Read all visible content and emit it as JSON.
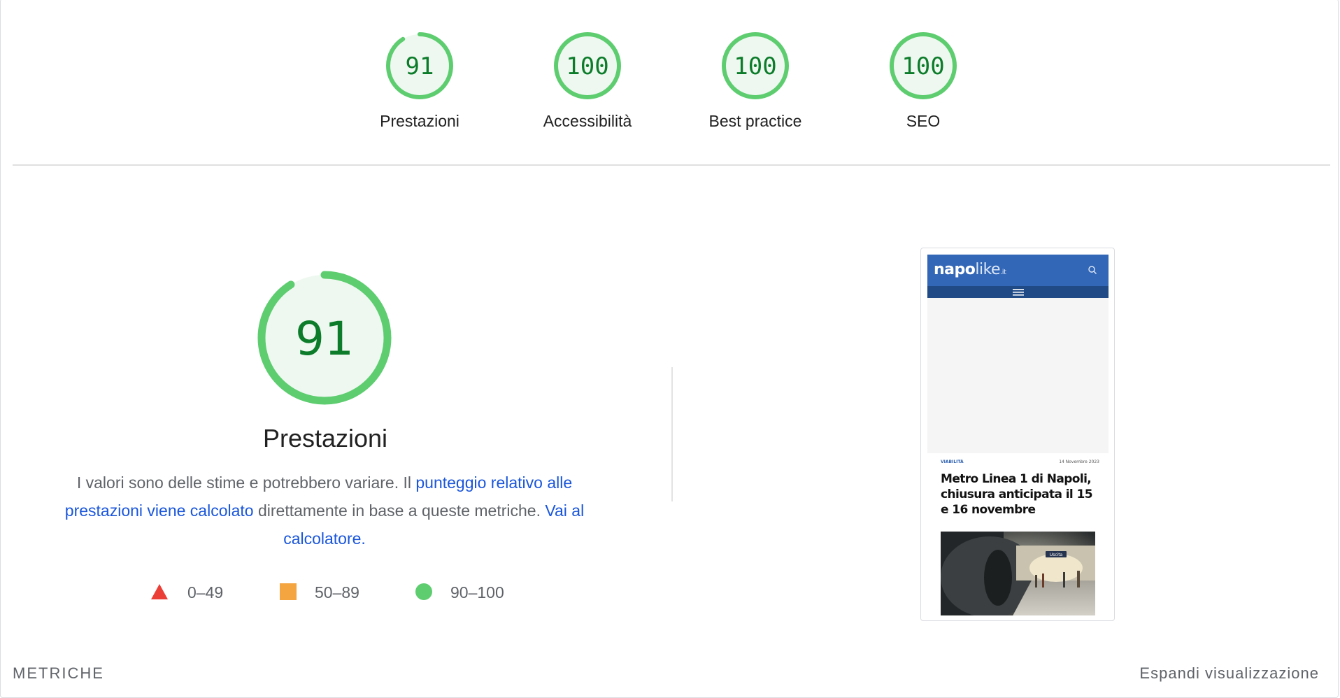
{
  "categories": [
    {
      "score": "91",
      "label": "Prestazioni",
      "fraction": 0.91
    },
    {
      "score": "100",
      "label": "Accessibilità",
      "fraction": 1.0
    },
    {
      "score": "100",
      "label": "Best practice",
      "fraction": 1.0
    },
    {
      "score": "100",
      "label": "SEO",
      "fraction": 1.0
    }
  ],
  "performance": {
    "score": "91",
    "fraction": 0.91,
    "title": "Prestazioni",
    "desc_part1": "I valori sono delle stime e potrebbero variare. Il ",
    "desc_link1": "punteggio relativo alle prestazioni viene calcolato",
    "desc_part2": " direttamente in base a queste metriche. ",
    "desc_link2": "Vai al calcolatore."
  },
  "legend": [
    {
      "range": "0–49",
      "shape": "triangle",
      "color": "#eb3e36"
    },
    {
      "range": "50–89",
      "shape": "square",
      "color": "#f4a540"
    },
    {
      "range": "90–100",
      "shape": "circle",
      "color": "#5ecd70"
    }
  ],
  "screenshot": {
    "logo_bold": "napo",
    "logo_light": "like",
    "logo_tld": ".it",
    "category": "VIABILITÀ",
    "date": "14 Novembre 2023",
    "headline": "Metro Linea 1 di Napoli, chiusura anticipata il 15 e 16 novembre",
    "sign": "Uscita"
  },
  "footer": {
    "metrics_label": "METRICHE",
    "expand_label": "Espandi visualizzazione"
  },
  "colors": {
    "pass": "#5ecd70",
    "pass_fill": "#eef8f0",
    "pass_text": "#0c7c2a",
    "link": "#1a56db",
    "brand_blue": "#3267b7"
  }
}
